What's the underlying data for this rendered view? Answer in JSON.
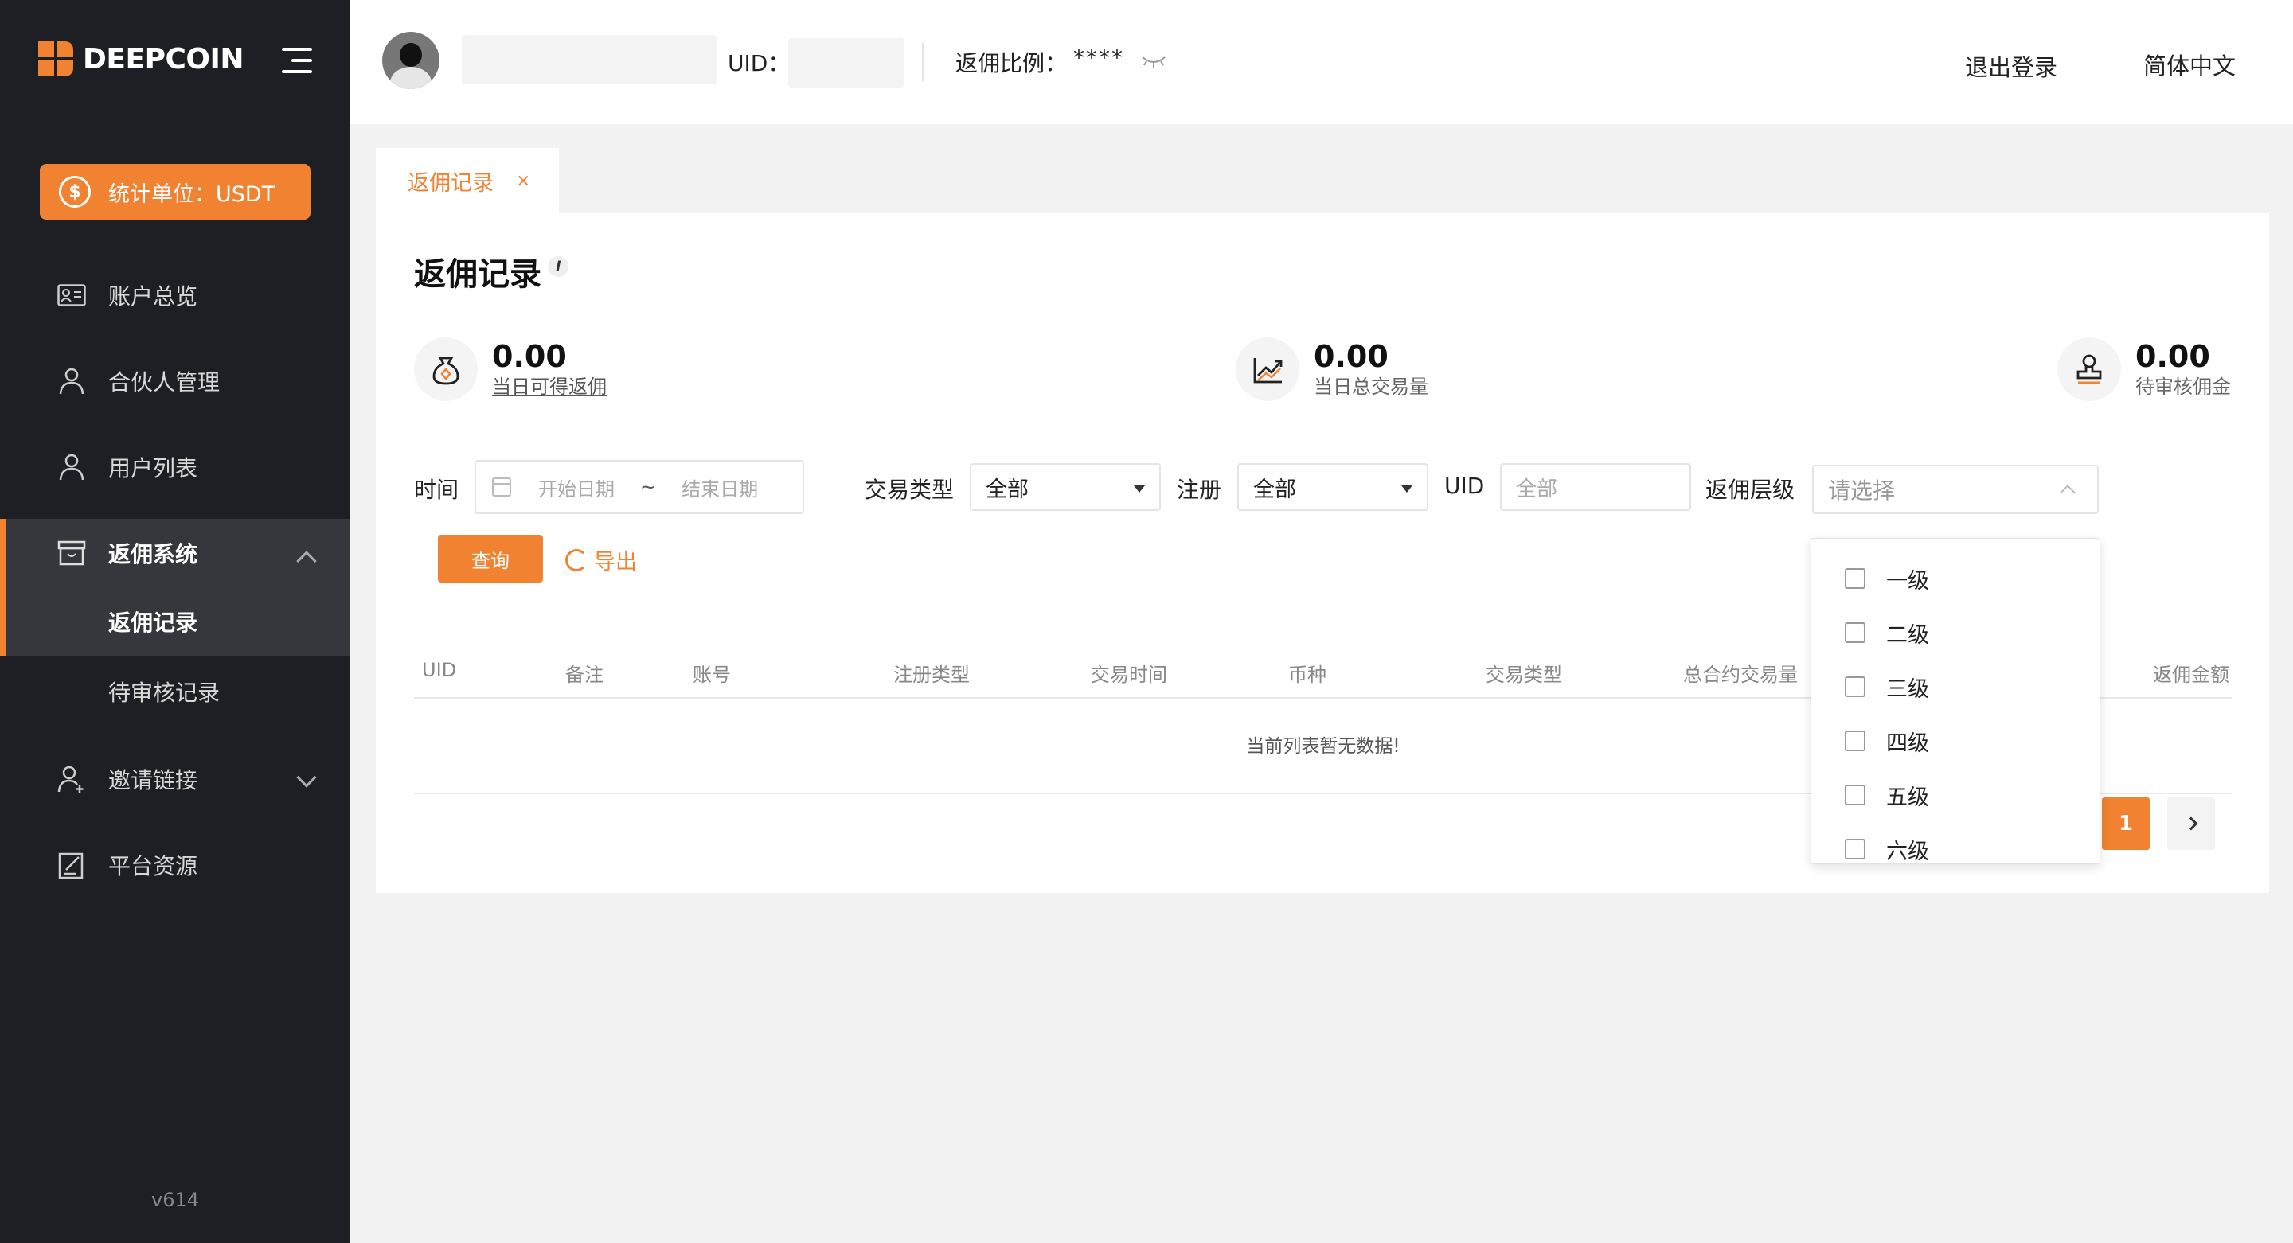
{
  "brand": {
    "name": "DEEPCOIN"
  },
  "sidebar": {
    "unit_label": "统计单位：USDT",
    "unit_icon": "$",
    "items": [
      {
        "label": "账户总览",
        "icon": "id-card-icon"
      },
      {
        "label": "合伙人管理",
        "icon": "person-icon"
      },
      {
        "label": "用户列表",
        "icon": "person-icon"
      },
      {
        "label": "返佣系统",
        "icon": "box-icon"
      },
      {
        "label": "邀请链接",
        "icon": "person-add-icon"
      },
      {
        "label": "平台资源",
        "icon": "edit-doc-icon"
      }
    ],
    "sub_items": [
      {
        "label": "返佣记录"
      },
      {
        "label": "待审核记录"
      }
    ],
    "version": "v614"
  },
  "header": {
    "uid_label": "UID：",
    "ratio_label": "返佣比例：",
    "ratio_value": "****",
    "logout": "退出登录",
    "language": "简体中文"
  },
  "tabs": [
    {
      "label": "返佣记录",
      "close": "×"
    }
  ],
  "main": {
    "title": "返佣记录",
    "info_icon": "i",
    "stats": [
      {
        "value": "0.00",
        "label": "当日可得返佣",
        "icon": "money-bag-icon"
      },
      {
        "value": "0.00",
        "label": "当日总交易量",
        "icon": "trend-chart-icon"
      },
      {
        "value": "0.00",
        "label": "待审核佣金",
        "icon": "stamp-icon"
      }
    ],
    "filters": {
      "time_label": "时间",
      "start_placeholder": "开始日期",
      "range_sep": "~",
      "end_placeholder": "结束日期",
      "trade_type_label": "交易类型",
      "trade_type_value": "全部",
      "register_label": "注册",
      "register_value": "全部",
      "uid_label": "UID",
      "uid_placeholder": "全部",
      "level_label": "返佣层级",
      "level_placeholder": "请选择"
    },
    "query_btn": "查询",
    "export_btn": "导出",
    "table": {
      "columns": [
        "UID",
        "备注",
        "账号",
        "注册类型",
        "交易时间",
        "币种",
        "交易类型",
        "总合约交易量",
        "返佣金额"
      ],
      "empty_text": "当前列表暂无数据!"
    },
    "pagination": {
      "current": "1"
    },
    "level_options": [
      "一级",
      "二级",
      "三级",
      "四级",
      "五级",
      "六级"
    ]
  },
  "colors": {
    "accent": "#f08232",
    "sidebar_bg": "#1d1f24"
  }
}
